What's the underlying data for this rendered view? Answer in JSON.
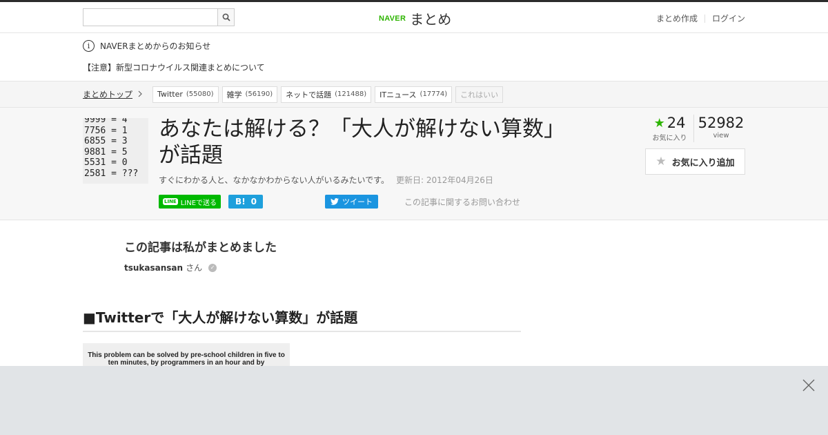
{
  "header": {
    "search_placeholder": "",
    "logo_brand": "NAVER",
    "logo_name": "まとめ",
    "links": [
      "まとめ作成",
      "ログイン"
    ]
  },
  "notice": {
    "icon": "i",
    "title": "NAVERまとめからのお知らせ",
    "body": "【注意】新型コロナウイルス関連まとめについて"
  },
  "catbar": {
    "crumb": "まとめトップ",
    "tags": [
      {
        "label": "Twitter",
        "count": "(55080)"
      },
      {
        "label": "雑学",
        "count": "(56190)"
      },
      {
        "label": "ネットで話題",
        "count": "(121488)"
      },
      {
        "label": "ITニュース",
        "count": "(17774)"
      },
      {
        "label": "これはいい",
        "count": ""
      }
    ]
  },
  "article": {
    "thumb_text": "9999 = 4\n7756 = 1\n6855 = 3\n9881 = 5\n5531 = 0\n2581 = ???",
    "title": "あなたは解ける？「大人が解けない算数」が話題",
    "description": "すぐにわかる人と、なかなかわからない人がいるみたいです。",
    "updated": "更新日: 2012年04月26日",
    "share": {
      "line_icon": "LINE",
      "line_label": "LINEで送る",
      "hatena_icon": "B!",
      "hatena_count": "0",
      "tweet_label": "ツイート",
      "contact": "この記事に関するお問い合わせ"
    },
    "stats": {
      "fav_count": "24",
      "fav_label": "お気に入り",
      "view_count": "52982",
      "view_label": "view"
    },
    "fav_button": "お気に入り追加"
  },
  "author": {
    "heading": "この記事は私がまとめました",
    "name": "tsukasansan",
    "suffix": "さん"
  },
  "section": {
    "heading": "■Twitterで「大人が解けない算数」が話題",
    "image_text": "This problem can be solved by pre-school children in five to ten minutes, by programmers in an hour and by"
  },
  "colors": {
    "naver_green": "#2db400",
    "line_green": "#00b900",
    "hatena_blue": "#1ea0dc",
    "twitter_blue": "#1b95e0"
  }
}
